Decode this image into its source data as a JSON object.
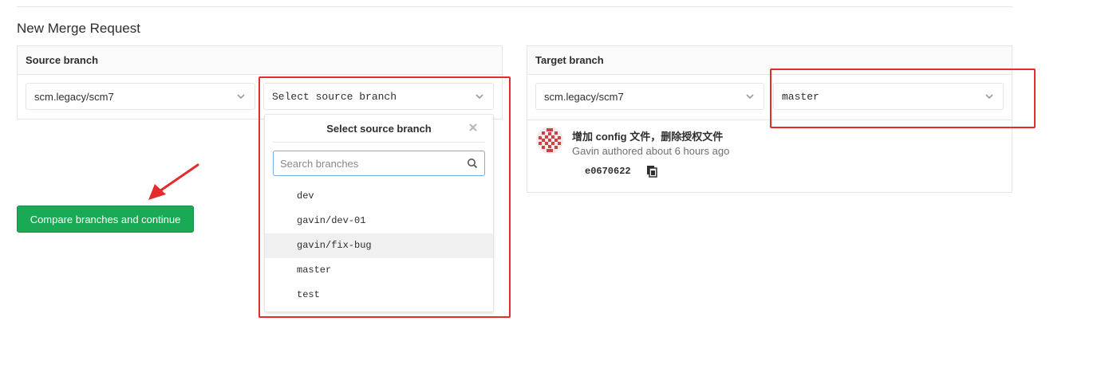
{
  "page": {
    "title": "New Merge Request"
  },
  "source": {
    "heading": "Source branch",
    "project_value": "scm.legacy/scm7",
    "branch_placeholder": "Select source branch",
    "dropdown": {
      "title": "Select source branch",
      "search_placeholder": "Search branches",
      "branches": [
        "dev",
        "gavin/dev-01",
        "gavin/fix-bug",
        "master",
        "test"
      ],
      "hovered_index": 2
    }
  },
  "target": {
    "heading": "Target branch",
    "project_value": "scm.legacy/scm7",
    "branch_value": "master",
    "commit": {
      "title": "增加 config 文件，删除授权文件",
      "meta": "Gavin authored about 6 hours ago",
      "sha": "e0670622"
    }
  },
  "actions": {
    "compare_label": "Compare branches and continue"
  },
  "colors": {
    "annotation_red": "#e52c2c",
    "primary_green": "#1aaa55",
    "search_focus": "#73afea"
  },
  "icons": {
    "chevron": "chevron-down-icon",
    "close": "close-icon",
    "search": "search-icon",
    "copy": "clipboard-icon",
    "avatar": "identicon-avatar",
    "arrow": "annotation-arrow"
  }
}
